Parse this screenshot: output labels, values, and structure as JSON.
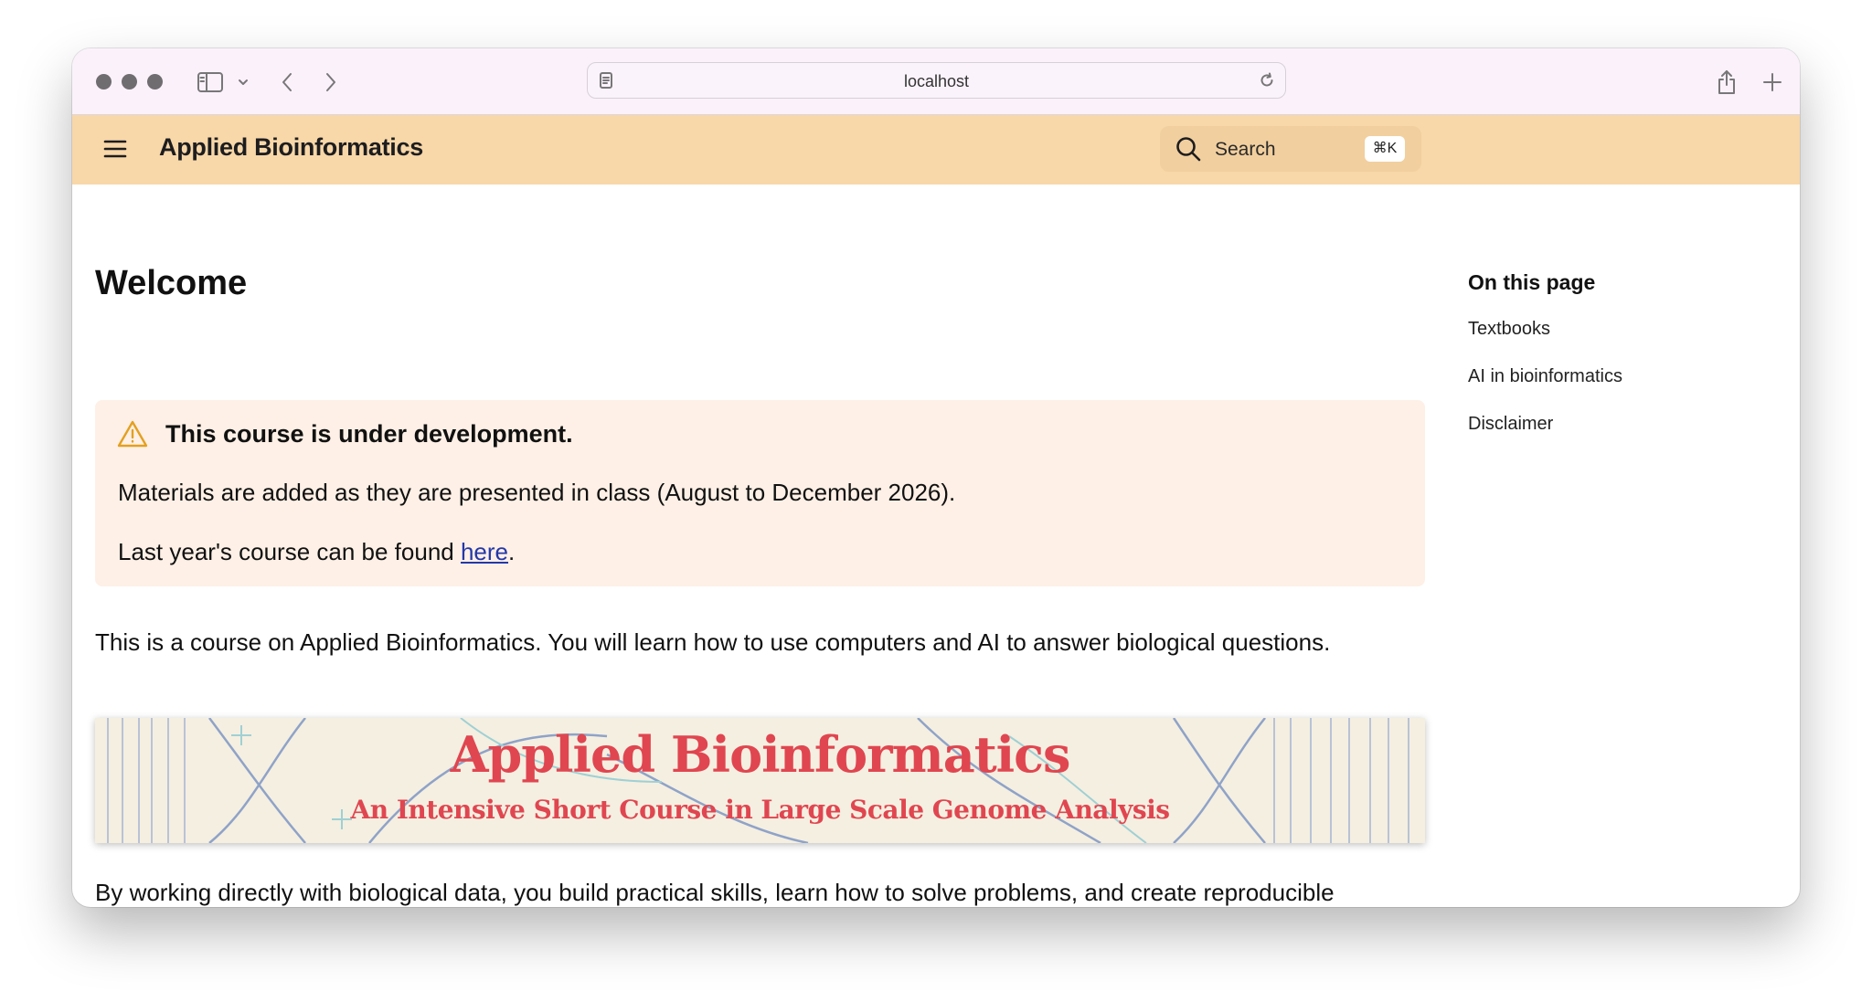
{
  "browser": {
    "url": "localhost"
  },
  "site": {
    "title": "Applied Bioinformatics",
    "search": {
      "label": "Search",
      "shortcut": "⌘K"
    }
  },
  "page": {
    "heading": "Welcome",
    "callout": {
      "title": "This course is under development.",
      "line1": "Materials are added as they are presented in class (August to December 2026).",
      "line2_prefix": "Last year's course can be found ",
      "line2_link": "here",
      "line2_suffix": "."
    },
    "intro": "This is a course on Applied Bioinformatics. You will learn how to use computers and AI to answer biological questions.",
    "banner": {
      "title": "Applied Bioinformatics",
      "subtitle": "An Intensive Short Course in Large Scale Genome Analysis"
    },
    "body": "By working directly with biological data, you build practical skills, learn how to solve problems, and create reproducible workflows that hold up in research."
  },
  "toc": {
    "title": "On this page",
    "items": [
      "Textbooks",
      "AI in bioinformatics",
      "Disclaimer"
    ]
  },
  "colors": {
    "header_bg": "#f8d7a8",
    "callout_bg": "#fef0e6",
    "warning_icon": "#e3a020",
    "banner_text": "#e04650",
    "link": "#2438a8"
  },
  "icons": {
    "menu": "hamburger-icon",
    "search": "search-icon",
    "warning": "warning-icon",
    "sidebar": "sidebar-icon",
    "back": "chevron-left-icon",
    "forward": "chevron-right-icon",
    "share": "share-icon",
    "new_tab": "plus-icon",
    "tabs": "tabs-overview-icon",
    "reload": "reload-icon",
    "reader": "reader-icon"
  }
}
